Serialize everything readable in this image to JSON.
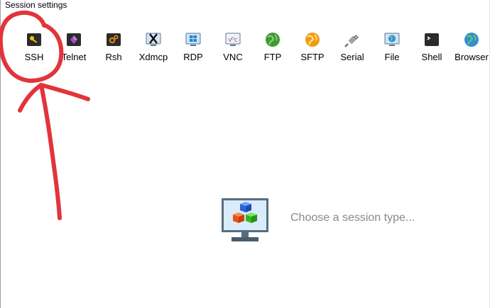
{
  "window": {
    "title": "Session settings"
  },
  "tools": [
    {
      "label": "SSH",
      "icon": "key-icon"
    },
    {
      "label": "Telnet",
      "icon": "telnet-icon"
    },
    {
      "label": "Rsh",
      "icon": "rsh-gear-icon"
    },
    {
      "label": "Xdmcp",
      "icon": "x-display-icon"
    },
    {
      "label": "RDP",
      "icon": "windows-monitor-icon"
    },
    {
      "label": "VNC",
      "icon": "vnc-monitor-icon"
    },
    {
      "label": "FTP",
      "icon": "ftp-globe-icon"
    },
    {
      "label": "SFTP",
      "icon": "sftp-globe-icon"
    },
    {
      "label": "Serial",
      "icon": "serial-plug-icon"
    },
    {
      "label": "File",
      "icon": "file-globe-monitor-icon"
    },
    {
      "label": "Shell",
      "icon": "terminal-icon"
    },
    {
      "label": "Browser",
      "icon": "browser-globe-icon"
    }
  ],
  "main": {
    "prompt": "Choose a session type..."
  },
  "colors": {
    "annotation": "#e2343a",
    "prompt_text": "#8a8a8a"
  }
}
